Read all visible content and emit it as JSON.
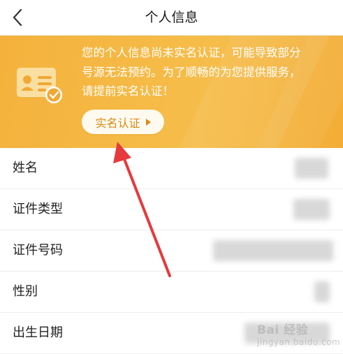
{
  "header": {
    "title": "个人信息"
  },
  "banner": {
    "message_lines": [
      "您的个人信息尚未实名认证，可能导致部分",
      "号源无法预约。为了顺畅的为您提供服务，",
      "请提前实名认证！"
    ],
    "verify_button_label": "实名认证",
    "background_color": "#f5b43f",
    "button_text_color": "#d98a12"
  },
  "profile_fields": [
    {
      "label": "姓名"
    },
    {
      "label": "证件类型"
    },
    {
      "label": "证件号码"
    },
    {
      "label": "性别"
    },
    {
      "label": "出生日期"
    }
  ],
  "annotation": {
    "color": "#e8393c"
  },
  "watermark": {
    "text": "Bai 经验",
    "sub": "jingyan.baidu.com"
  }
}
